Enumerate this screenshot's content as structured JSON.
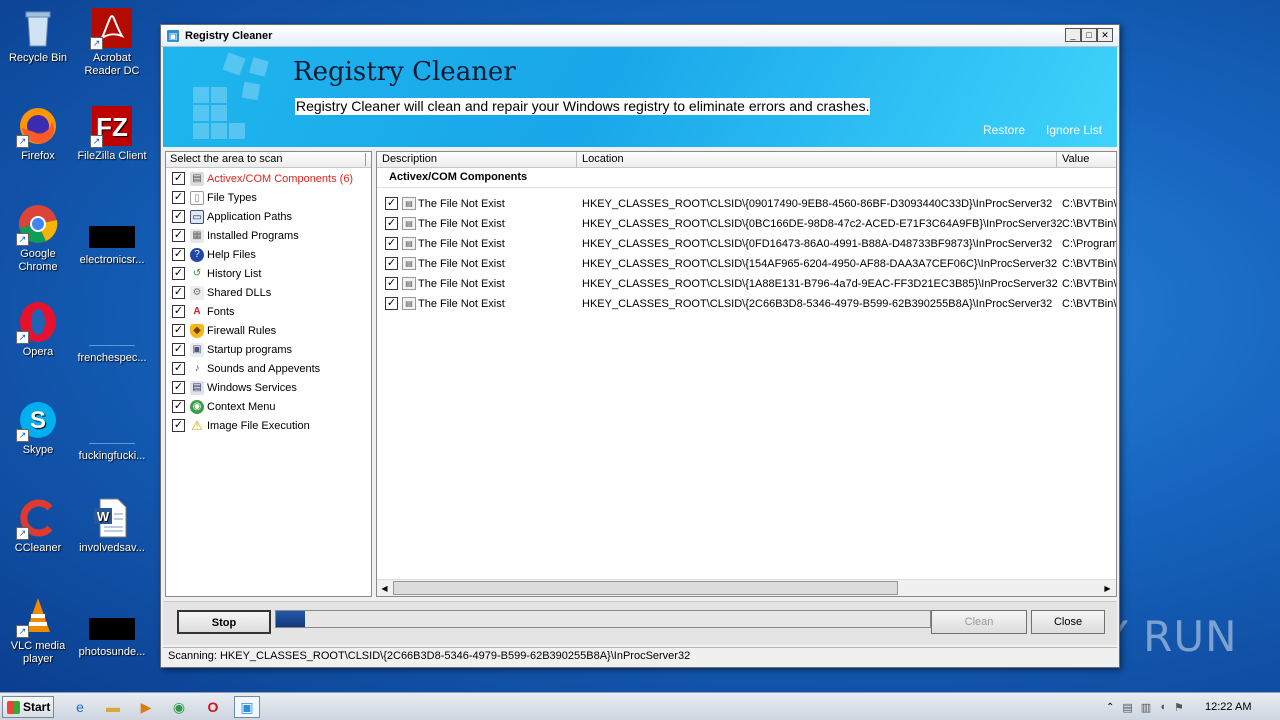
{
  "desktop": {
    "icons": [
      {
        "label": "Recycle Bin",
        "icon": "recycle-bin-icon"
      },
      {
        "label": "Acrobat Reader DC",
        "icon": "acrobat-icon"
      },
      {
        "label": "Firefox",
        "icon": "firefox-icon"
      },
      {
        "label": "FileZilla Client",
        "icon": "filezilla-icon"
      },
      {
        "label": "Google Chrome",
        "icon": "chrome-icon"
      },
      {
        "label": "electronicsr...",
        "icon": "redacted-file-icon"
      },
      {
        "label": "Opera",
        "icon": "opera-icon"
      },
      {
        "label": "frenchespec...",
        "icon": "blank-file-icon"
      },
      {
        "label": "Skype",
        "icon": "skype-icon"
      },
      {
        "label": "fuckingfucki...",
        "icon": "blank-file-icon"
      },
      {
        "label": "CCleaner",
        "icon": "ccleaner-icon"
      },
      {
        "label": "involvedsav...",
        "icon": "word-doc-icon"
      },
      {
        "label": "VLC media player",
        "icon": "vlc-icon"
      },
      {
        "label": "photosunde...",
        "icon": "redacted-file-icon"
      }
    ]
  },
  "window": {
    "title": "Registry Cleaner",
    "banner_title": "Registry Cleaner",
    "banner_subtitle": "Registry Cleaner will clean and repair your Windows registry to eliminate errors and crashes.",
    "restore": "Restore",
    "ignore_list": "Ignore List"
  },
  "left_pane": {
    "header": "Select the area to scan",
    "items": [
      {
        "label": "Activex/COM Components (6)",
        "icon": "activex-icon",
        "checked": true,
        "active": true
      },
      {
        "label": "File Types",
        "icon": "file-types-icon",
        "checked": true
      },
      {
        "label": "Application Paths",
        "icon": "app-paths-icon",
        "checked": true
      },
      {
        "label": "Installed Programs",
        "icon": "installed-programs-icon",
        "checked": true
      },
      {
        "label": "Help Files",
        "icon": "help-icon",
        "checked": true
      },
      {
        "label": "History List",
        "icon": "history-icon",
        "checked": true
      },
      {
        "label": "Shared DLLs",
        "icon": "dll-icon",
        "checked": true
      },
      {
        "label": "Fonts",
        "icon": "fonts-icon",
        "checked": true
      },
      {
        "label": "Firewall Rules",
        "icon": "firewall-icon",
        "checked": true
      },
      {
        "label": "Startup programs",
        "icon": "startup-icon",
        "checked": true
      },
      {
        "label": "Sounds and Appevents",
        "icon": "sounds-icon",
        "checked": true
      },
      {
        "label": "Windows Services",
        "icon": "services-icon",
        "checked": true
      },
      {
        "label": "Context Menu",
        "icon": "context-menu-icon",
        "checked": true
      },
      {
        "label": "Image File Execution",
        "icon": "warning-icon",
        "checked": true
      }
    ]
  },
  "results": {
    "columns": [
      "Description",
      "Location",
      "Value"
    ],
    "group": "Activex/COM Components",
    "rows": [
      {
        "desc": "The File Not Exist",
        "loc": "HKEY_CLASSES_ROOT\\CLSID\\{09017490-9EB8-4560-86BF-D3093440C33D}\\InProcServer32",
        "val": "C:\\BVTBin\\"
      },
      {
        "desc": "The File Not Exist",
        "loc": "HKEY_CLASSES_ROOT\\CLSID\\{0BC166DE-98D8-47c2-ACED-E71F3C64A9FB}\\InProcServer32",
        "val": "C:\\BVTBin\\"
      },
      {
        "desc": "The File Not Exist",
        "loc": "HKEY_CLASSES_ROOT\\CLSID\\{0FD16473-86A0-4991-B88A-D48733BF9873}\\InProcServer32",
        "val": "C:\\Program"
      },
      {
        "desc": "The File Not Exist",
        "loc": "HKEY_CLASSES_ROOT\\CLSID\\{154AF965-6204-4950-AF88-DAA3A7CEF06C}\\InProcServer32",
        "val": "C:\\BVTBin\\"
      },
      {
        "desc": "The File Not Exist",
        "loc": "HKEY_CLASSES_ROOT\\CLSID\\{1A88E131-B796-4a7d-9EAC-FF3D21EC3B85}\\InProcServer32",
        "val": "C:\\BVTBin\\"
      },
      {
        "desc": "The File Not Exist",
        "loc": "HKEY_CLASSES_ROOT\\CLSID\\{2C66B3D8-5346-4979-B599-62B390255B8A}\\InProcServer32",
        "val": "C:\\BVTBin\\"
      }
    ]
  },
  "bottom": {
    "stop": "Stop",
    "clean": "Clean",
    "close": "Close",
    "progress": 0.045,
    "status": "Scanning: HKEY_CLASSES_ROOT\\CLSID\\{2C66B3D8-5346-4979-B599-62B390255B8A}\\InProcServer32"
  },
  "taskbar": {
    "start": "Start",
    "clock": "12:22 AM"
  },
  "watermark": "ANY RUN"
}
